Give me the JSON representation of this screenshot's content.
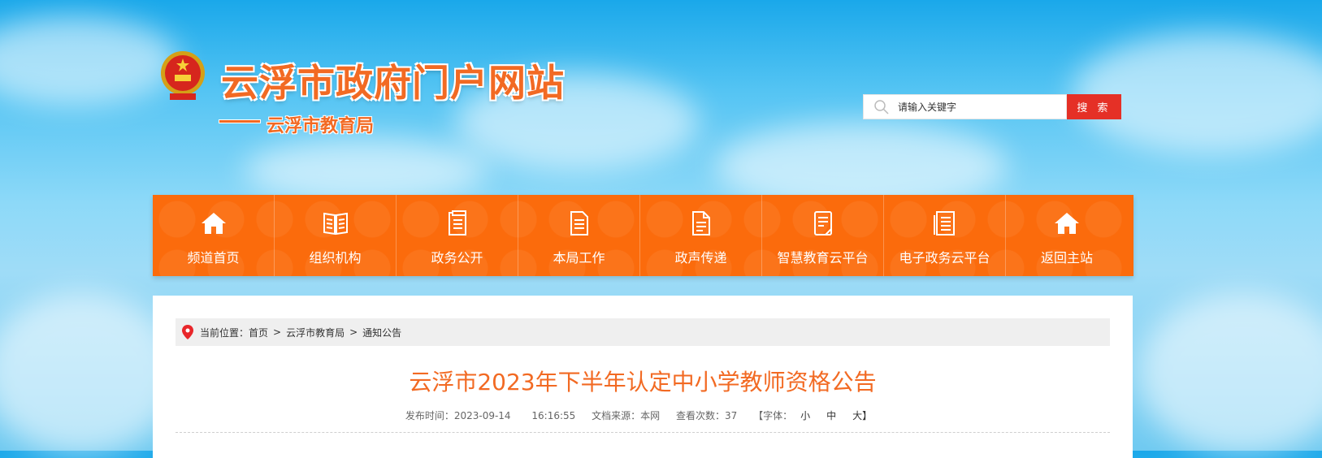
{
  "header": {
    "site_title": "云浮市政府门户网站",
    "sub_title": "云浮市教育局"
  },
  "search": {
    "placeholder": "请输入关键字",
    "button_label": "搜 索"
  },
  "nav": {
    "items": [
      {
        "label": "频道首页",
        "icon": "home-icon"
      },
      {
        "label": "组织机构",
        "icon": "book-icon"
      },
      {
        "label": "政务公开",
        "icon": "document-icon"
      },
      {
        "label": "本局工作",
        "icon": "file-list-icon"
      },
      {
        "label": "政声传递",
        "icon": "file-text-icon"
      },
      {
        "label": "智慧教育云平台",
        "icon": "notebook-icon"
      },
      {
        "label": "电子政务云平台",
        "icon": "list-document-icon"
      },
      {
        "label": "返回主站",
        "icon": "home-icon"
      }
    ]
  },
  "breadcrumb": {
    "prefix": "当前位置：",
    "items": [
      "首页",
      "云浮市教育局",
      "通知公告"
    ],
    "separator": ">"
  },
  "article": {
    "title": "云浮市2023年下半年认定中小学教师资格公告",
    "publish_label": "发布时间：",
    "publish_date": "2023-09-14",
    "publish_time": "16:16:55",
    "source_label": "文档来源：",
    "source": "本网",
    "views_label": "查看次数：",
    "views": "37",
    "font_label": "【字体：",
    "font_small": "小",
    "font_medium": "中",
    "font_large": "大】"
  },
  "colors": {
    "brand_orange": "#f26a23",
    "nav_bg": "#fb6b0c",
    "search_button": "#e53026",
    "pin_red": "#e8262a"
  }
}
